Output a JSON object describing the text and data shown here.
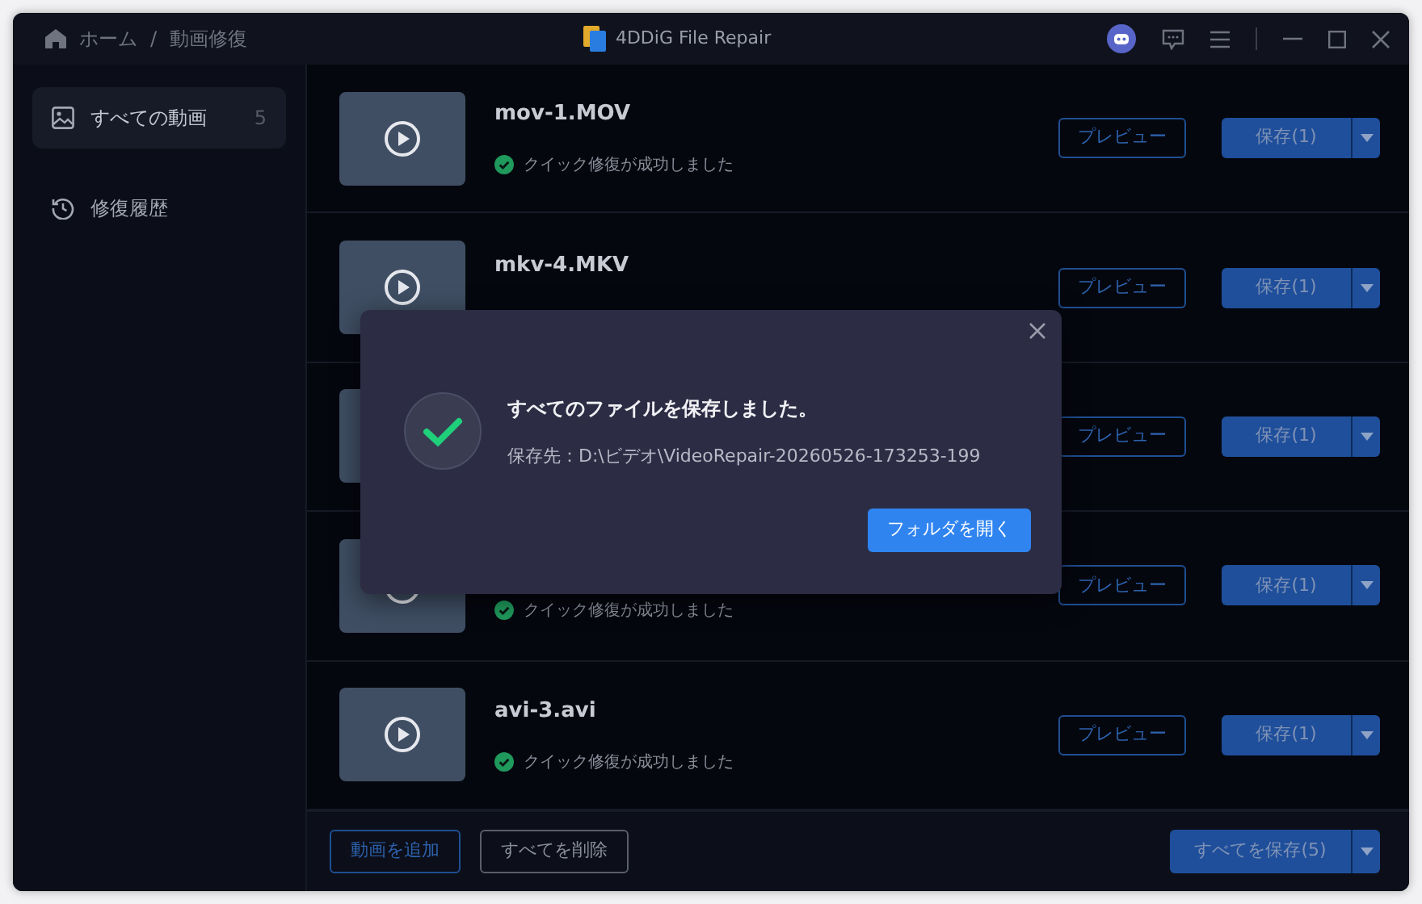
{
  "titlebar": {
    "breadcrumb": [
      "ホーム",
      "動画修復"
    ],
    "separator": "/",
    "app_name": "4DDiG File Repair"
  },
  "sidebar": {
    "items": [
      {
        "kind": "videos",
        "label": "すべての動画",
        "count": "5",
        "selected": true
      },
      {
        "kind": "history",
        "label": "修復履歴",
        "selected": false
      }
    ]
  },
  "files": [
    {
      "name": "mov-1.MOV",
      "status": "クイック修復が成功しました",
      "preview": "プレビュー",
      "save": "保存(1)"
    },
    {
      "name": "mkv-4.MKV",
      "preview": "プレビュー",
      "save": "保存(1)"
    },
    {
      "preview": "プレビュー",
      "save": "保存(1)"
    },
    {
      "status": "クイック修復が成功しました",
      "preview": "プレビュー",
      "save": "保存(1)"
    },
    {
      "name": "avi-3.avi",
      "status": "クイック修復が成功しました",
      "preview": "プレビュー",
      "save": "保存(1)"
    }
  ],
  "footer": {
    "add": "動画を追加",
    "delete_all": "すべてを削除",
    "save_all": "すべてを保存(5)"
  },
  "dialog": {
    "title": "すべてのファイルを保存しました。",
    "path": "保存先：D:\\ビデオ\\VideoRepair-20260526-173253-199",
    "button": "フォルダを開く"
  }
}
